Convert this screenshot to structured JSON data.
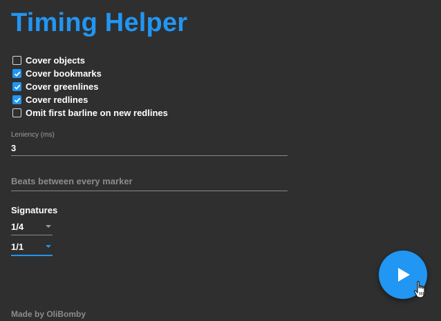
{
  "title": "Timing Helper",
  "options": [
    {
      "label": "Cover objects",
      "checked": false
    },
    {
      "label": "Cover bookmarks",
      "checked": true
    },
    {
      "label": "Cover greenlines",
      "checked": true
    },
    {
      "label": "Cover redlines",
      "checked": true
    },
    {
      "label": "Omit first barline on new redlines",
      "checked": false
    }
  ],
  "leniency": {
    "label": "Leniency (ms)",
    "value": "3"
  },
  "beats": {
    "placeholder": "Beats between every marker",
    "value": ""
  },
  "signatures": {
    "title": "Signatures",
    "selects": [
      {
        "value": "1/4",
        "focused": false
      },
      {
        "value": "1/1",
        "focused": true
      }
    ]
  },
  "footer": "Made by OliBomby",
  "icons": {
    "checkbox": "checkbox-icon",
    "dropdown": "chevron-down-icon",
    "run": "play-icon",
    "cursor": "hand-pointer-icon"
  },
  "colors": {
    "accent": "#2196f3",
    "background": "#2f2f2f",
    "muted": "#8c8c8c"
  }
}
